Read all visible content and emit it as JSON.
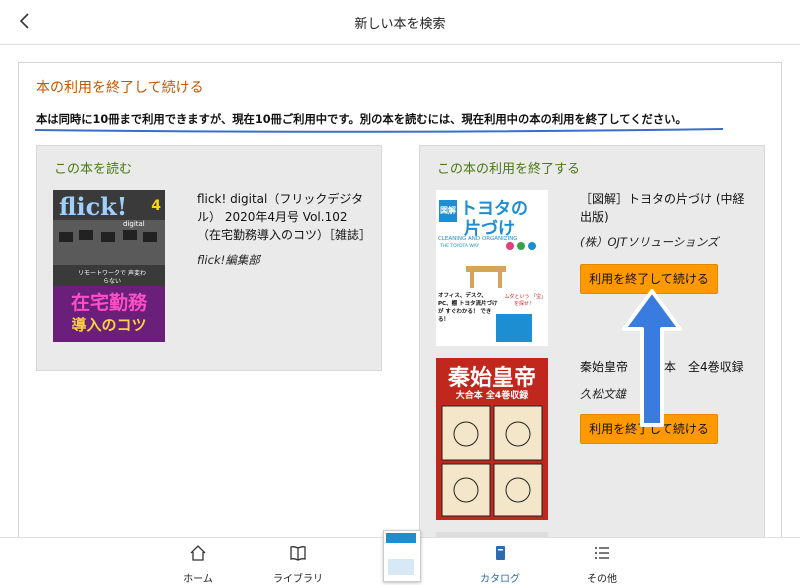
{
  "header": {
    "title": "新しい本を検索",
    "back_icon": "chevron-left-icon"
  },
  "panel": {
    "title": "本の利用を終了して続ける",
    "notice": "本は同時に10冊まで利用できますが、現在10冊ご利用中です。別の本を読むには、現在利用中の本の利用を終了してください。"
  },
  "read_card": {
    "title": "この本を読む",
    "book": {
      "title": "flick! digital（フリックデジタル） 2020年4月号 Vol.102（在宅勤務導入のコツ）［雑誌］",
      "author": "flick!編集部",
      "cover": {
        "brand": "flick!",
        "sub": "digital",
        "issue": "4",
        "caption": "リモートワークで 声変わらない",
        "headline1": "在宅勤務",
        "headline2": "導入のコツ"
      }
    }
  },
  "end_card": {
    "title": "この本の利用を終了する",
    "books": [
      {
        "title": "［図解］トヨタの片づけ (中経出版)",
        "author": "(株）OJTソリューションズ",
        "button": "利用を終了して続ける",
        "cover": {
          "tag": "図解",
          "headline1": "トヨタの",
          "headline2": "片づけ",
          "en": "CLEANING AND ORGANIZING",
          "en2": "THE TOYOTA WAY",
          "lead": "オフィス、デスク、PC、棚 トヨタ流片づけが すぐわかる！ できる！",
          "bubble": "ムダという 「宝」を探せ！"
        }
      },
      {
        "title": "秦始皇帝　大合本　全4巻収録",
        "author": "久松文雄",
        "button": "利用を終了して続ける",
        "cover": {
          "headline": "秦始皇帝",
          "sub": "大合本 全4巻収録"
        }
      }
    ]
  },
  "bottom_nav": [
    {
      "label": "ホーム",
      "icon": "home-icon"
    },
    {
      "label": "ライブラリ",
      "icon": "book-open-icon"
    },
    {
      "label": "カタログ",
      "icon": "catalog-icon",
      "active": true
    },
    {
      "label": "その他",
      "icon": "menu-icon"
    }
  ],
  "colors": {
    "accent_orange": "#ff9900",
    "title_orange": "#c45500",
    "card_title_green": "#4a7a12",
    "active_blue": "#2b6cb0",
    "arrow_blue": "#3a7be0"
  }
}
